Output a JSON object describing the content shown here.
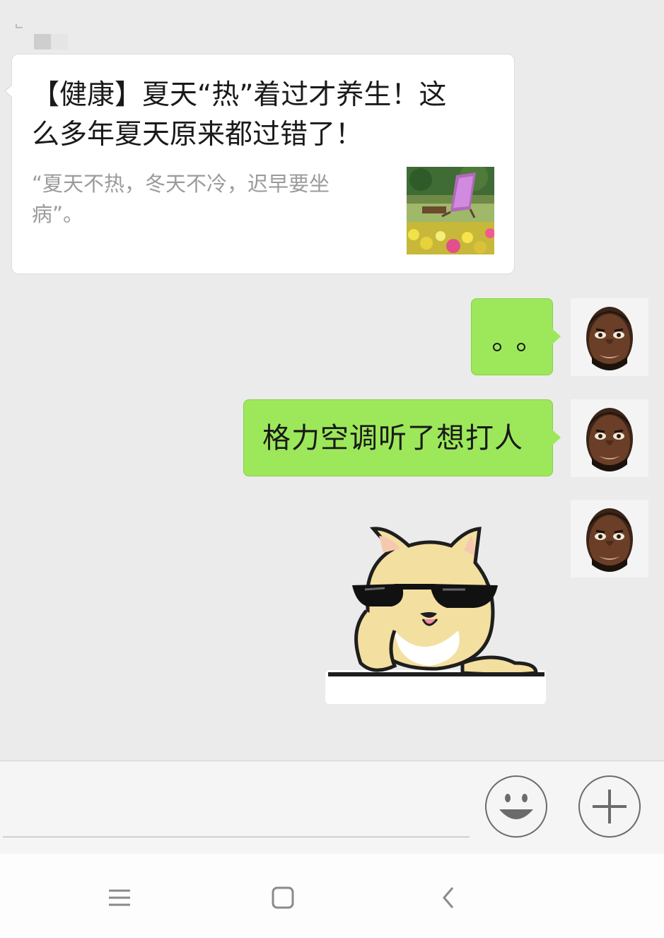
{
  "colors": {
    "chat_bg": "#ebebeb",
    "bubble_green": "#9de85a",
    "card_bg": "#ffffff",
    "desc_gray": "#9b9b9b"
  },
  "article": {
    "title_line1": "【健康】夏天“热”着过才养生！这",
    "title_line2": "么多年夏天原来都过错了！",
    "desc_line1": "“夏天不热，冬天不冷，迟早要坐",
    "desc_line2": "病”。",
    "thumbnail_icon": "garden-lounge-chair-photo"
  },
  "messages": [
    {
      "kind": "text",
      "dots_count": 2,
      "avatar_icon": "man-face-avatar"
    },
    {
      "kind": "text",
      "text": "格力空调听了想打人",
      "avatar_icon": "man-face-avatar"
    },
    {
      "kind": "sticker",
      "sticker_icon": "shiba-dog-sunglasses-sticker",
      "avatar_icon": "man-face-avatar"
    }
  ],
  "input_bar": {
    "emoji_icon": "smiley-icon",
    "plus_icon": "plus-icon"
  },
  "nav_bar": {
    "menu_icon": "menu-icon",
    "home_icon": "home-square-icon",
    "back_icon": "back-chevron-icon"
  }
}
